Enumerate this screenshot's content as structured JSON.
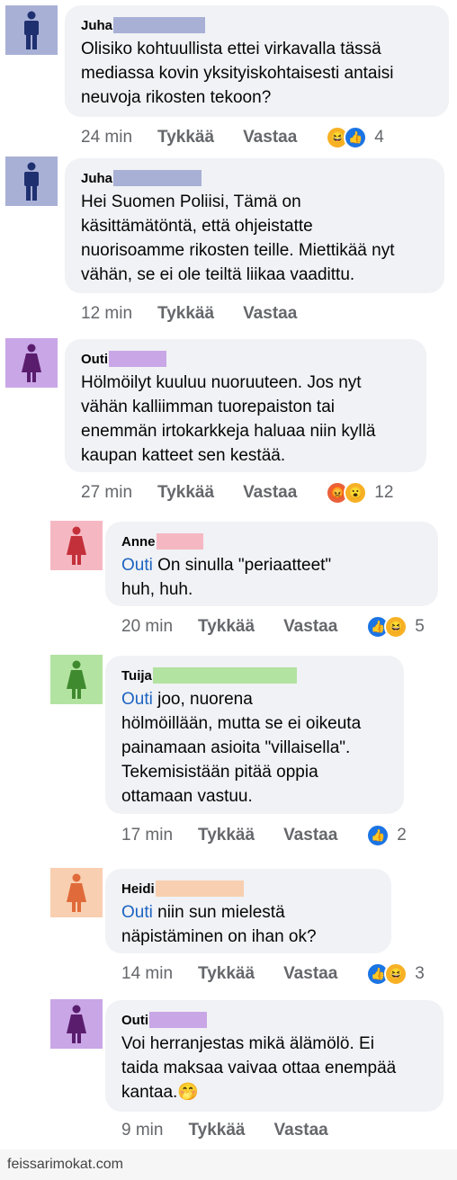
{
  "actions": {
    "like": "Tykkää",
    "reply": "Vastaa"
  },
  "colors": {
    "juha": "#a8b0d6",
    "outi": "#c9a6e6",
    "anne": "#f5b8c3",
    "tuija": "#b3e3a1",
    "heidi": "#f8cfb0",
    "mention": "#1d64c2",
    "bubble": "#f0f2f5"
  },
  "comments": [
    {
      "author": "Juha",
      "mention": "",
      "text": "Olisiko kohtuullista ettei virkavalla tässä\nmediassa kovin yksityiskohtaisesti antaisi\nneuvoja rikosten tekoon?",
      "time": "24 min",
      "reactions": [
        "haha-icon",
        "like-icon"
      ],
      "count": "4"
    },
    {
      "author": "Juha",
      "mention": "",
      "text": "Hei Suomen Poliisi, Tämä on\nkäsittämätöntä, että ohjeistatte\nnuorisoamme rikosten teille. Miettikää nyt\nvähän, se ei ole teiltä liikaa vaadittu.",
      "time": "12 min",
      "reactions": [],
      "count": ""
    },
    {
      "author": "Outi",
      "mention": "",
      "text": "Hölmöilyt kuuluu nuoruuteen. Jos nyt\nvähän kalliimman tuorepaiston tai\nenemmän irtokarkkeja haluaa niin kyllä\nkaupan katteet sen kestää.",
      "time": "27 min",
      "reactions": [
        "angry-icon",
        "wow-icon"
      ],
      "count": "12"
    },
    {
      "author": "Anne",
      "mention": "Outi",
      "text": " On sinulla \"periaatteet\"\nhuh, huh.",
      "time": "20 min",
      "reactions": [
        "like-icon",
        "haha-icon"
      ],
      "count": "5"
    },
    {
      "author": "Tuija",
      "mention": "Outi",
      "text": " joo, nuorena\nhölmöillään, mutta se ei oikeuta\npainamaan asioita \"villaisella\".\nTekemisistään pitää oppia\nottamaan vastuu.",
      "time": "17 min",
      "reactions": [
        "like-icon"
      ],
      "count": "2"
    },
    {
      "author": "Heidi",
      "mention": "Outi",
      "text": " niin sun mielestä\nnäpistäminen on ihan ok?",
      "time": "14 min",
      "reactions": [
        "like-icon",
        "haha-icon"
      ],
      "count": "3"
    },
    {
      "author": "Outi",
      "mention": "",
      "text": "Voi herranjestas mikä älämölö. Ei\ntaida maksaa vaivaa ottaa enempää\nkantaa.🤭",
      "time": "9 min",
      "reactions": [],
      "count": ""
    }
  ],
  "watermark": "feissarimokat.com"
}
